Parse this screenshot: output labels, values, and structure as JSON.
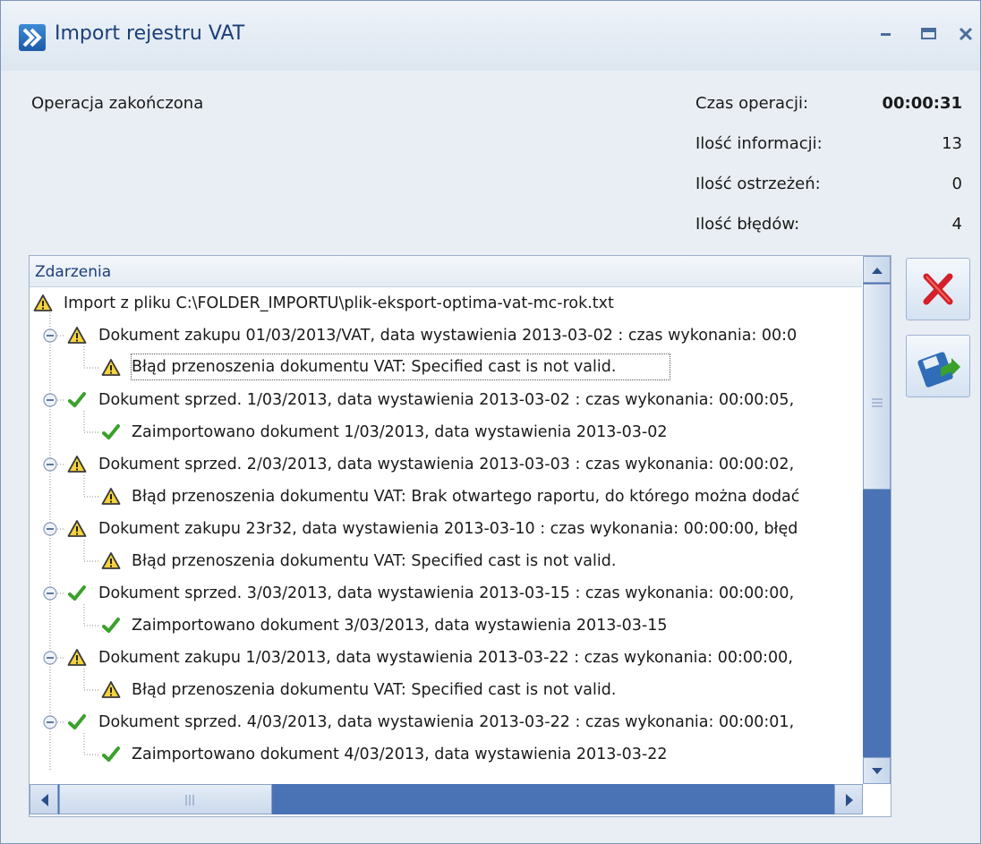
{
  "window": {
    "title": "Import rejestru VAT",
    "app_icon": "arrow-forward-icon",
    "controls": [
      "minimize-icon",
      "maximize-icon",
      "close-icon"
    ]
  },
  "summary": {
    "status": "Operacja zakończona",
    "stats": [
      {
        "label": "Czas operacji:",
        "value": "00:00:31",
        "bold": true
      },
      {
        "label": "Ilość informacji:",
        "value": "13"
      },
      {
        "label": "Ilość ostrzeżeń:",
        "value": "0"
      },
      {
        "label": "Ilość błędów:",
        "value": "4"
      }
    ]
  },
  "events": {
    "header": "Zdarzenia",
    "rows": [
      {
        "level": 0,
        "icon": "warning-icon",
        "text": "Import z pliku C:\\FOLDER_IMPORTU\\plik-eksport-optima-vat-mc-rok.txt"
      },
      {
        "level": 1,
        "icon": "warning-icon",
        "expander": true,
        "text": "Dokument zakupu 01/03/2013/VAT, data wystawienia 2013-03-02 : czas wykonania: 00:0"
      },
      {
        "level": 2,
        "icon": "warning-icon",
        "selected": true,
        "text": "Błąd przenoszenia dokumentu VAT: Specified cast is not valid."
      },
      {
        "level": 1,
        "icon": "check-icon",
        "expander": true,
        "text": "Dokument sprzed. 1/03/2013, data wystawienia 2013-03-02 : czas wykonania: 00:00:05,"
      },
      {
        "level": 2,
        "icon": "check-icon",
        "text": "Zaimportowano dokument 1/03/2013, data wystawienia 2013-03-02"
      },
      {
        "level": 1,
        "icon": "warning-icon",
        "expander": true,
        "text": "Dokument sprzed. 2/03/2013, data wystawienia 2013-03-03 : czas wykonania: 00:00:02,"
      },
      {
        "level": 2,
        "icon": "warning-icon",
        "text": "Błąd przenoszenia dokumentu VAT: Brak otwartego raportu, do którego można dodać"
      },
      {
        "level": 1,
        "icon": "warning-icon",
        "expander": true,
        "text": "Dokument zakupu 23r32, data wystawienia 2013-03-10 : czas wykonania: 00:00:00, błęd"
      },
      {
        "level": 2,
        "icon": "warning-icon",
        "text": "Błąd przenoszenia dokumentu VAT: Specified cast is not valid."
      },
      {
        "level": 1,
        "icon": "check-icon",
        "expander": true,
        "text": "Dokument sprzed. 3/03/2013, data wystawienia 2013-03-15 : czas wykonania: 00:00:00,"
      },
      {
        "level": 2,
        "icon": "check-icon",
        "text": "Zaimportowano dokument 3/03/2013, data wystawienia 2013-03-15"
      },
      {
        "level": 1,
        "icon": "warning-icon",
        "expander": true,
        "text": "Dokument zakupu 1/03/2013, data wystawienia 2013-03-22 : czas wykonania: 00:00:00,"
      },
      {
        "level": 2,
        "icon": "warning-icon",
        "text": "Błąd przenoszenia dokumentu VAT: Specified cast is not valid."
      },
      {
        "level": 1,
        "icon": "check-icon",
        "expander": true,
        "text": "Dokument sprzed. 4/03/2013, data wystawienia 2013-03-22 : czas wykonania: 00:00:01,"
      },
      {
        "level": 2,
        "icon": "check-icon",
        "text": "Zaimportowano dokument 4/03/2013, data wystawienia 2013-03-22"
      }
    ]
  },
  "side_buttons": [
    {
      "icon": "cancel-x-icon"
    },
    {
      "icon": "save-export-icon"
    }
  ],
  "colors": {
    "title_text": "#1b3e7a",
    "scroll_track": "#4a73b6",
    "check_green": "#3aa12b",
    "warning_yellow": "#f4d33b",
    "cancel_red": "#d4202a"
  }
}
